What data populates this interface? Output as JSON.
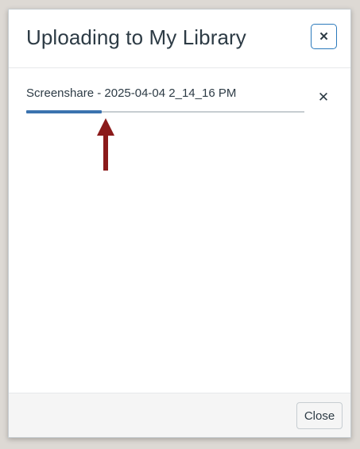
{
  "modal": {
    "title": "Uploading to My Library",
    "close_icon": "close-icon"
  },
  "upload": {
    "file_name": "Screenshare - 2025-04-04 2_14_16 PM",
    "progress_percent": 27,
    "remove_icon": "close-icon"
  },
  "annotation": {
    "arrow_color": "#8b1a1a"
  },
  "footer": {
    "close_label": "Close"
  },
  "colors": {
    "progress": "#3b73af",
    "track": "#c7cdd1",
    "focus_border": "#2b7abc",
    "text": "#2d3b45"
  }
}
